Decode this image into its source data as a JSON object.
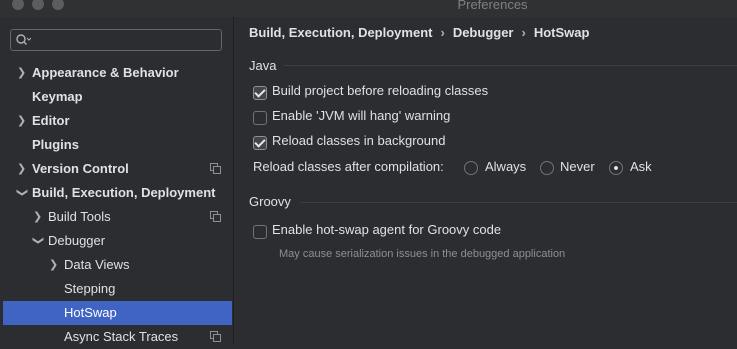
{
  "window": {
    "title": "Preferences"
  },
  "search": {
    "placeholder": "",
    "value": ""
  },
  "sidebar": {
    "items": [
      {
        "label": "Appearance & Behavior",
        "expandable": true,
        "expanded": false,
        "bold": true
      },
      {
        "label": "Keymap",
        "expandable": false,
        "bold": true
      },
      {
        "label": "Editor",
        "expandable": true,
        "expanded": false,
        "bold": true
      },
      {
        "label": "Plugins",
        "expandable": false,
        "bold": true
      },
      {
        "label": "Version Control",
        "expandable": true,
        "expanded": false,
        "bold": true,
        "project_icon": true
      },
      {
        "label": "Build, Execution, Deployment",
        "expandable": true,
        "expanded": true,
        "bold": true
      },
      {
        "label": "Build Tools",
        "expandable": true,
        "expanded": false,
        "project_icon": true
      },
      {
        "label": "Debugger",
        "expandable": true,
        "expanded": true
      },
      {
        "label": "Data Views",
        "expandable": true,
        "expanded": false
      },
      {
        "label": "Stepping",
        "expandable": false
      },
      {
        "label": "HotSwap",
        "expandable": false,
        "selected": true
      },
      {
        "label": "Async Stack Traces",
        "expandable": false,
        "project_icon": true
      }
    ]
  },
  "breadcrumb": [
    "Build, Execution, Deployment",
    "Debugger",
    "HotSwap"
  ],
  "java": {
    "title": "Java",
    "options": [
      {
        "label": "Build project before reloading classes",
        "checked": true
      },
      {
        "label": "Enable 'JVM will hang' warning",
        "checked": false
      },
      {
        "label": "Reload classes in background",
        "checked": true
      }
    ],
    "reload_label": "Reload classes after compilation:",
    "reload_options": [
      {
        "label": "Always",
        "selected": false
      },
      {
        "label": "Never",
        "selected": false
      },
      {
        "label": "Ask",
        "selected": true
      }
    ]
  },
  "groovy": {
    "title": "Groovy",
    "option": {
      "label": "Enable hot-swap agent for Groovy code",
      "checked": false
    },
    "hint": "May cause serialization issues in the debugged application"
  }
}
